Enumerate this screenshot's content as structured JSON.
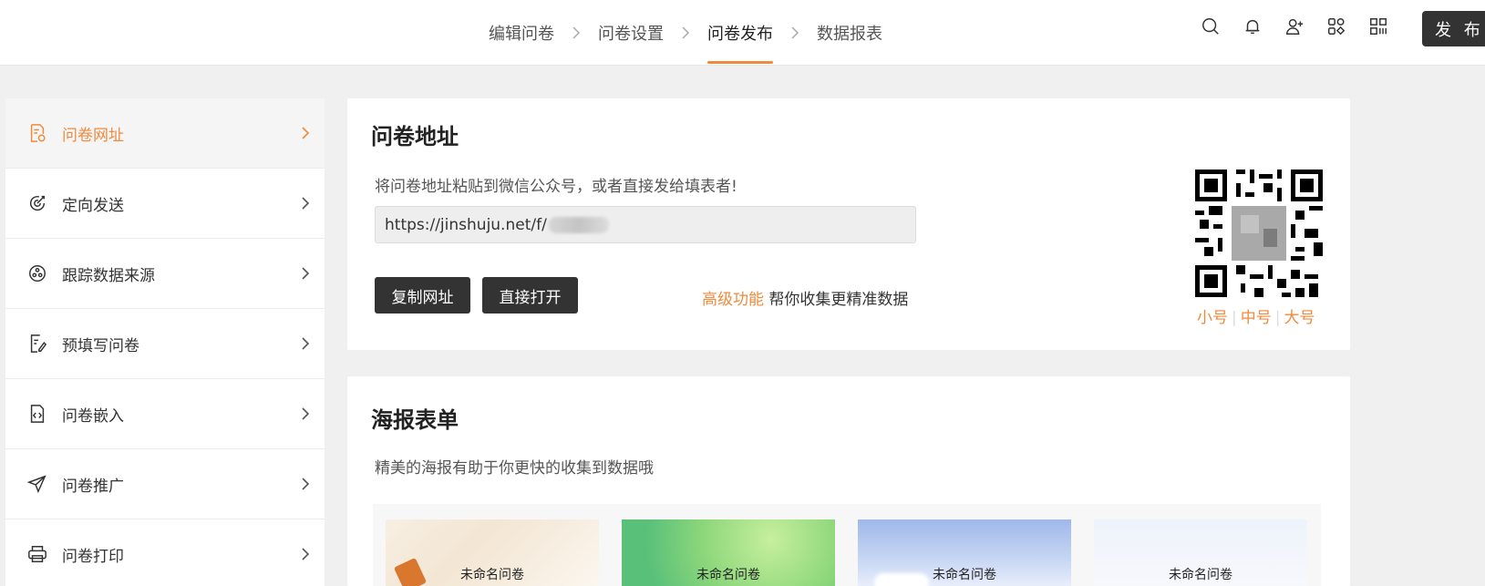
{
  "topbar": {
    "steps": [
      {
        "label": "编辑问卷",
        "active": false
      },
      {
        "label": "问卷设置",
        "active": false
      },
      {
        "label": "问卷发布",
        "active": true
      },
      {
        "label": "数据报表",
        "active": false
      }
    ],
    "tools": [
      "search-icon",
      "bell-icon",
      "add-user-icon",
      "apps-icon",
      "qr-grid-icon"
    ],
    "publish_label": "发 布"
  },
  "sidebar": {
    "items": [
      {
        "label": "问卷网址",
        "icon": "form-link-icon",
        "active": true
      },
      {
        "label": "定向发送",
        "icon": "target-icon",
        "active": false
      },
      {
        "label": "跟踪数据来源",
        "icon": "source-icon",
        "active": false
      },
      {
        "label": "预填写问卷",
        "icon": "prefill-icon",
        "active": false
      },
      {
        "label": "问卷嵌入",
        "icon": "embed-icon",
        "active": false
      },
      {
        "label": "问卷推广",
        "icon": "send-icon",
        "active": false
      },
      {
        "label": "问卷打印",
        "icon": "printer-icon",
        "active": false
      }
    ]
  },
  "url_card": {
    "title": "问卷地址",
    "description": "将问卷地址粘贴到微信公众号，或者直接发给填表者!",
    "url_prefix": "https://jinshuju.net/f/",
    "copy_label": "复制网址",
    "open_label": "直接打开",
    "advanced_link": "高级功能",
    "advanced_text": "帮你收集更精准数据",
    "qr_sizes": [
      "小号",
      "中号",
      "大号"
    ]
  },
  "poster_card": {
    "title": "海报表单",
    "description": "精美的海报有助于你更快的收集到数据哦",
    "posters": [
      {
        "title": "未命名问卷"
      },
      {
        "title": "未命名问卷"
      },
      {
        "title": "未命名问卷"
      },
      {
        "title": "未命名问卷"
      }
    ]
  },
  "colors": {
    "accent": "#f08a3c",
    "dark_button": "#333333"
  }
}
